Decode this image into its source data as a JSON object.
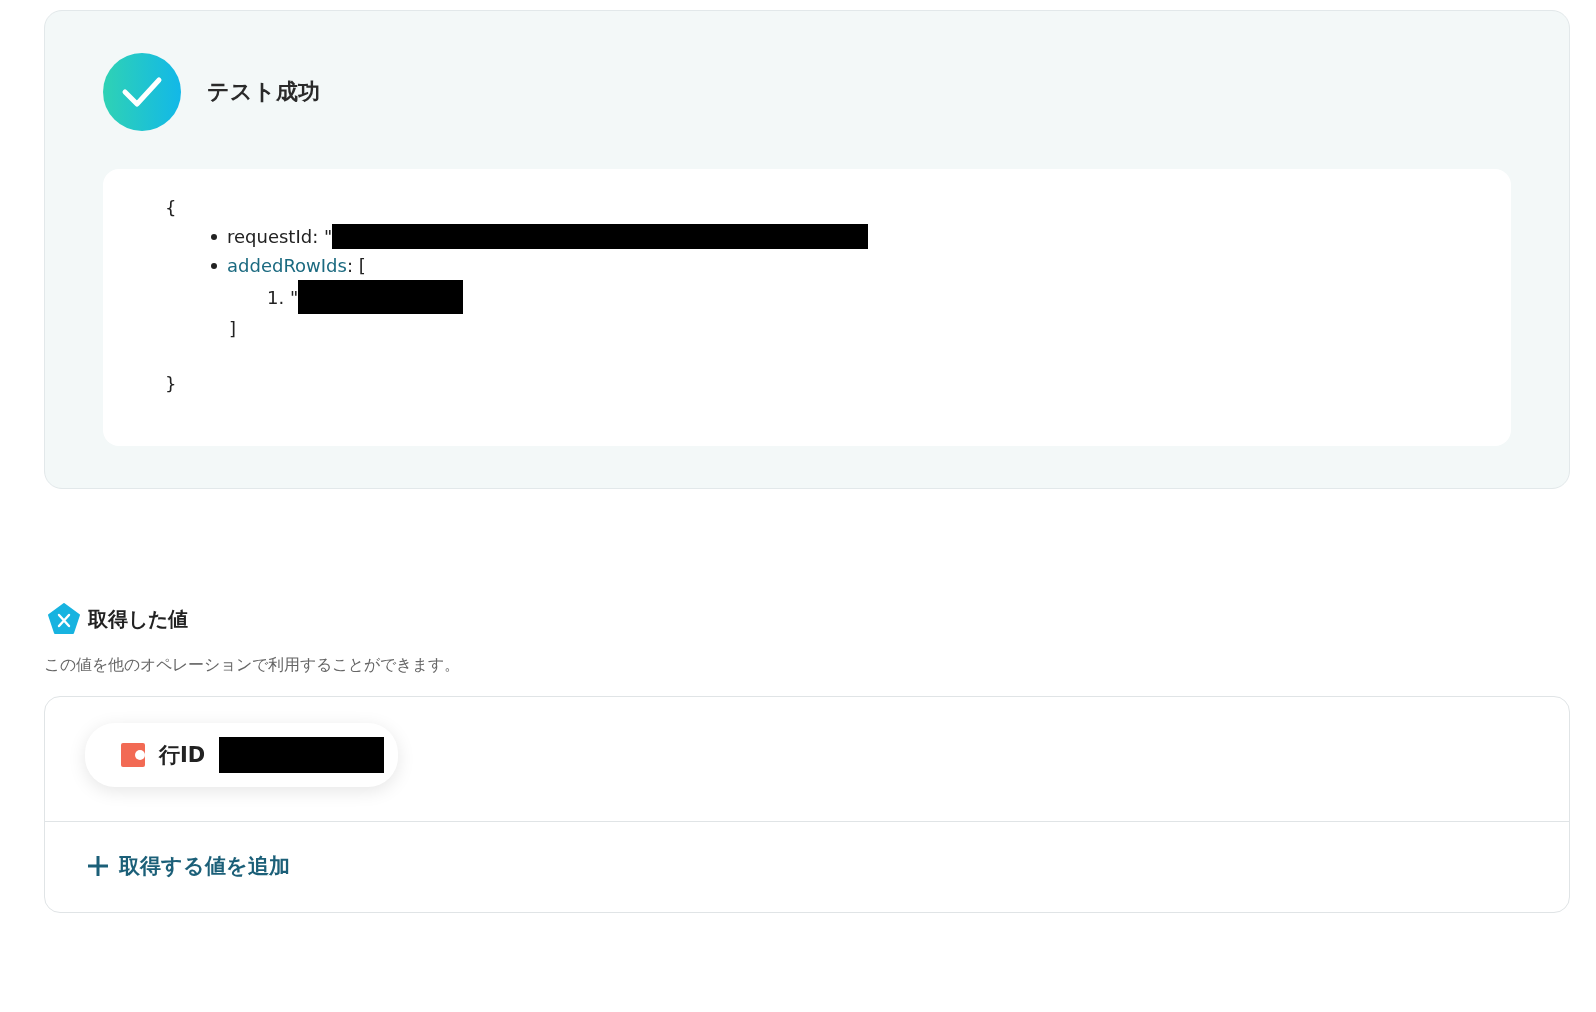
{
  "result": {
    "title": "テスト成功",
    "json": {
      "open": "{",
      "close": "}",
      "fields": [
        {
          "kind": "string",
          "key": "requestId",
          "separator": ": \"",
          "link": false
        },
        {
          "kind": "array",
          "key": "addedRowIds",
          "separator": ": [",
          "link": true,
          "items": [
            {
              "number": "1.",
              "quote": "\""
            }
          ],
          "end": "]"
        }
      ]
    }
  },
  "values": {
    "title": "取得した値",
    "description": "この値を他のオペレーションで利用することができます。",
    "items": [
      {
        "label": "行ID"
      }
    ],
    "add_button": "取得する値を追加"
  }
}
